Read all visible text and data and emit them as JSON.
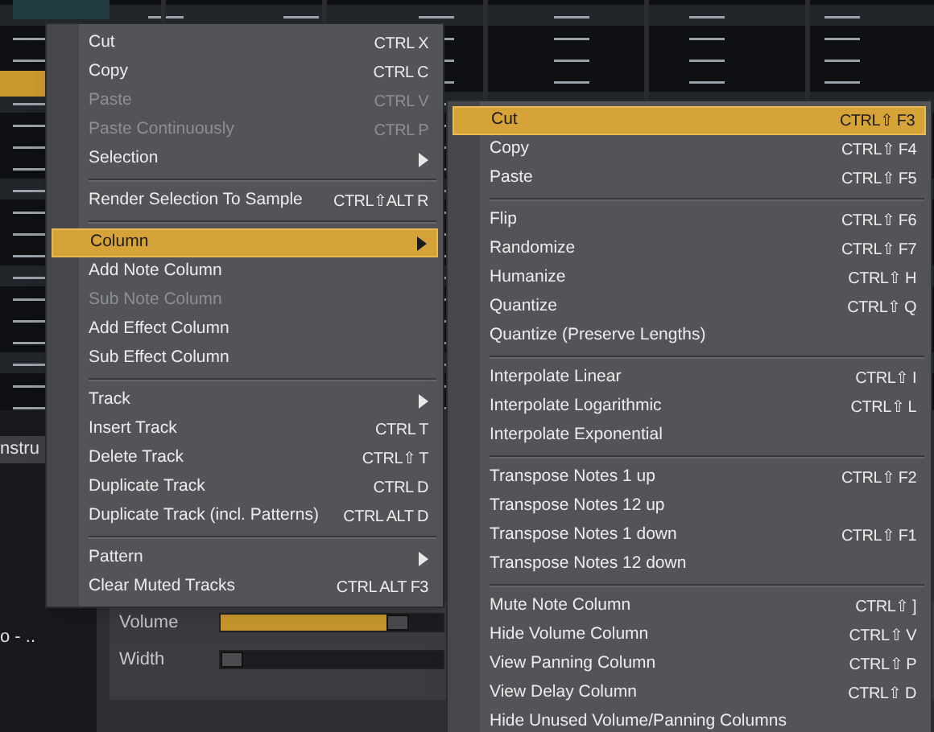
{
  "background": {
    "instrument_tab": "nstru",
    "list_entry": "o - ..",
    "sliders": [
      {
        "label": "Volume",
        "level": 0.8
      },
      {
        "label": "Width",
        "level": 0.0
      }
    ]
  },
  "menus": [
    {
      "items": [
        {
          "kind": "item",
          "label": "Cut",
          "shortcut": "CTRL X",
          "disabled": false,
          "selected": false
        },
        {
          "kind": "item",
          "label": "Copy",
          "shortcut": "CTRL C",
          "disabled": false,
          "selected": false
        },
        {
          "kind": "item",
          "label": "Paste",
          "shortcut": "CTRL V",
          "disabled": true,
          "selected": false
        },
        {
          "kind": "item",
          "label": "Paste Continuously",
          "shortcut": "CTRL P",
          "disabled": true,
          "selected": false
        },
        {
          "kind": "submenu",
          "label": "Selection",
          "disabled": false,
          "selected": false
        },
        {
          "kind": "separator"
        },
        {
          "kind": "item",
          "label": "Render Selection To Sample",
          "shortcut": "CTRL⇧ALT R",
          "disabled": false,
          "selected": false
        },
        {
          "kind": "separator"
        },
        {
          "kind": "submenu",
          "label": "Column",
          "disabled": false,
          "selected": true
        },
        {
          "kind": "item",
          "label": "Add Note Column",
          "disabled": false,
          "selected": false
        },
        {
          "kind": "item",
          "label": "Sub Note Column",
          "disabled": true,
          "selected": false
        },
        {
          "kind": "item",
          "label": "Add Effect Column",
          "disabled": false,
          "selected": false
        },
        {
          "kind": "item",
          "label": "Sub Effect Column",
          "disabled": false,
          "selected": false
        },
        {
          "kind": "separator"
        },
        {
          "kind": "submenu",
          "label": "Track",
          "disabled": false,
          "selected": false
        },
        {
          "kind": "item",
          "label": "Insert Track",
          "shortcut": "CTRL T",
          "disabled": false,
          "selected": false
        },
        {
          "kind": "item",
          "label": "Delete Track",
          "shortcut": "CTRL⇧ T",
          "disabled": false,
          "selected": false
        },
        {
          "kind": "item",
          "label": "Duplicate Track",
          "shortcut": "CTRL D",
          "disabled": false,
          "selected": false
        },
        {
          "kind": "item",
          "label": "Duplicate Track (incl. Patterns)",
          "shortcut": "CTRL ALT D",
          "disabled": false,
          "selected": false
        },
        {
          "kind": "separator"
        },
        {
          "kind": "submenu",
          "label": "Pattern",
          "disabled": false,
          "selected": false
        },
        {
          "kind": "item",
          "label": "Clear Muted Tracks",
          "shortcut": "CTRL ALT F3",
          "disabled": false,
          "selected": false
        }
      ]
    },
    {
      "items": [
        {
          "kind": "item",
          "label": "Cut",
          "shortcut": "CTRL⇧ F3",
          "disabled": false,
          "selected": true
        },
        {
          "kind": "item",
          "label": "Copy",
          "shortcut": "CTRL⇧ F4",
          "disabled": false,
          "selected": false
        },
        {
          "kind": "item",
          "label": "Paste",
          "shortcut": "CTRL⇧ F5",
          "disabled": false,
          "selected": false
        },
        {
          "kind": "separator"
        },
        {
          "kind": "item",
          "label": "Flip",
          "shortcut": "CTRL⇧ F6",
          "disabled": false,
          "selected": false
        },
        {
          "kind": "item",
          "label": "Randomize",
          "shortcut": "CTRL⇧ F7",
          "disabled": false,
          "selected": false
        },
        {
          "kind": "item",
          "label": "Humanize",
          "shortcut": "CTRL⇧ H",
          "disabled": false,
          "selected": false
        },
        {
          "kind": "item",
          "label": "Quantize",
          "shortcut": "CTRL⇧ Q",
          "disabled": false,
          "selected": false
        },
        {
          "kind": "item",
          "label": "Quantize (Preserve Lengths)",
          "disabled": false,
          "selected": false
        },
        {
          "kind": "separator"
        },
        {
          "kind": "item",
          "label": "Interpolate Linear",
          "shortcut": "CTRL⇧ I",
          "disabled": false,
          "selected": false
        },
        {
          "kind": "item",
          "label": "Interpolate Logarithmic",
          "shortcut": "CTRL⇧ L",
          "disabled": false,
          "selected": false
        },
        {
          "kind": "item",
          "label": "Interpolate Exponential",
          "disabled": false,
          "selected": false
        },
        {
          "kind": "separator"
        },
        {
          "kind": "item",
          "label": "Transpose Notes 1 up",
          "shortcut": "CTRL⇧ F2",
          "disabled": false,
          "selected": false
        },
        {
          "kind": "item",
          "label": "Transpose Notes 12 up",
          "disabled": false,
          "selected": false
        },
        {
          "kind": "item",
          "label": "Transpose Notes 1 down",
          "shortcut": "CTRL⇧ F1",
          "disabled": false,
          "selected": false
        },
        {
          "kind": "item",
          "label": "Transpose Notes 12 down",
          "disabled": false,
          "selected": false
        },
        {
          "kind": "separator"
        },
        {
          "kind": "item",
          "label": "Mute Note Column",
          "shortcut": "CTRL⇧ ]",
          "disabled": false,
          "selected": false
        },
        {
          "kind": "item",
          "label": "Hide Volume Column",
          "shortcut": "CTRL⇧ V",
          "disabled": false,
          "selected": false
        },
        {
          "kind": "item",
          "label": "View Panning Column",
          "shortcut": "CTRL⇧ P",
          "disabled": false,
          "selected": false
        },
        {
          "kind": "item",
          "label": "View Delay Column",
          "shortcut": "CTRL⇧ D",
          "disabled": false,
          "selected": false
        },
        {
          "kind": "item",
          "label": "Hide Unused Volume/Panning Columns",
          "disabled": false,
          "selected": false
        }
      ]
    }
  ]
}
